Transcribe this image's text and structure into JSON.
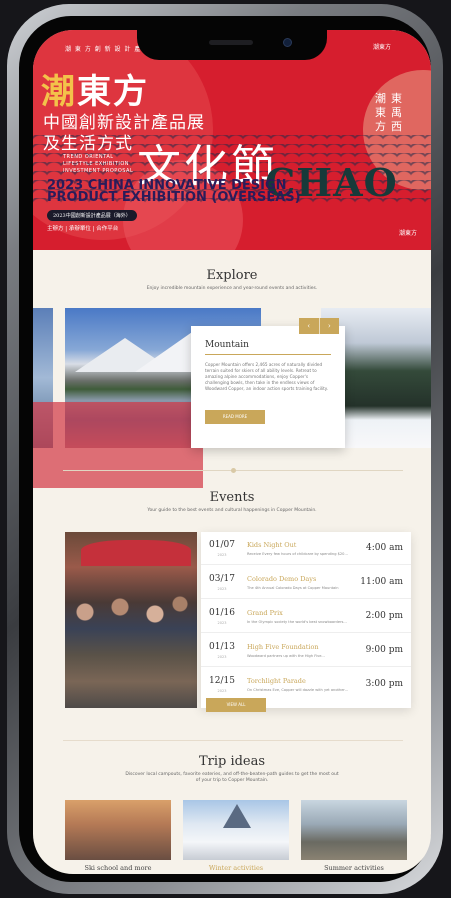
{
  "banner": {
    "top_line": "潮 東 方 創 新 設 計 產 品 展",
    "top_logo": "潮東方",
    "cn_line1_gold": "潮",
    "cn_line1_rest": "東方",
    "cn_line2": "中國創新設計產品展",
    "cn_line3": "及生活方式",
    "cn_big": "文化節",
    "en_small": [
      "TREND ORIENTAL",
      "LIFESTYLE EXHIBITION",
      "INVESTMENT PROPOSAL"
    ],
    "chao": "CHAO",
    "vertical_left": "潮東方",
    "vertical_right": "東禹西",
    "en_title": "2023 CHINA INNOVATIVE DESIGN PRODUCT EXHIBITION (OVERSEAS)",
    "pill": "2023中國創新設計產品展（海外）",
    "orgs": "主辦方 | 承辦單位 | 合作平台",
    "corner_mark": "潮東方"
  },
  "explore": {
    "title": "Explore",
    "subtitle": "Enjoy incredible mountain experience and year-round events and activities.",
    "card_title": "Mountain",
    "card_text": "Copper Mountain offers 2,465 acres of naturally divided terrain suited for skiers of all ability levels. Retreat to amazing alpine accommodations, enjoy Copper's challenging bowls, then take in the endless views of Woodward Copper, an indoor action sports training facility.",
    "card_button": "READ MORE",
    "prev_arrow": "‹",
    "next_arrow": "›"
  },
  "events": {
    "title": "Events",
    "subtitle": "Your guide to the best events and cultural happenings in Copper Mountain.",
    "items": [
      {
        "date": "01/07",
        "year": "2023",
        "name": "Kids Night Out",
        "desc": "Receive Every few hours of childcare by spending $20...",
        "time": "4:00 am"
      },
      {
        "date": "03/17",
        "year": "2023",
        "name": "Colorado Demo Days",
        "desc": "The 4th Annual Colorado Days at Copper Mountain",
        "time": "11:00 am"
      },
      {
        "date": "01/16",
        "year": "2023",
        "name": "Grand Prix",
        "desc": "In the Olympic society the world's best snowboarders...",
        "time": "2:00 pm"
      },
      {
        "date": "01/13",
        "year": "2023",
        "name": "High Five Foundation",
        "desc": "Woodward partners up with the High Five...",
        "time": "9:00 pm"
      },
      {
        "date": "12/15",
        "year": "2023",
        "name": "Torchlight Parade",
        "desc": "On Christmas Eve, Copper will dazzle with yet another...",
        "time": "3:00 pm"
      }
    ],
    "see_all": "VIEW ALL"
  },
  "trip": {
    "title": "Trip ideas",
    "subtitle": "Discover local campouts, favorite eateries, and off-the-beaten-path guides to get the most out of your trip to Copper Mountain.",
    "items": [
      "Ski school and more",
      "Winter activities",
      "Summer activities"
    ]
  }
}
